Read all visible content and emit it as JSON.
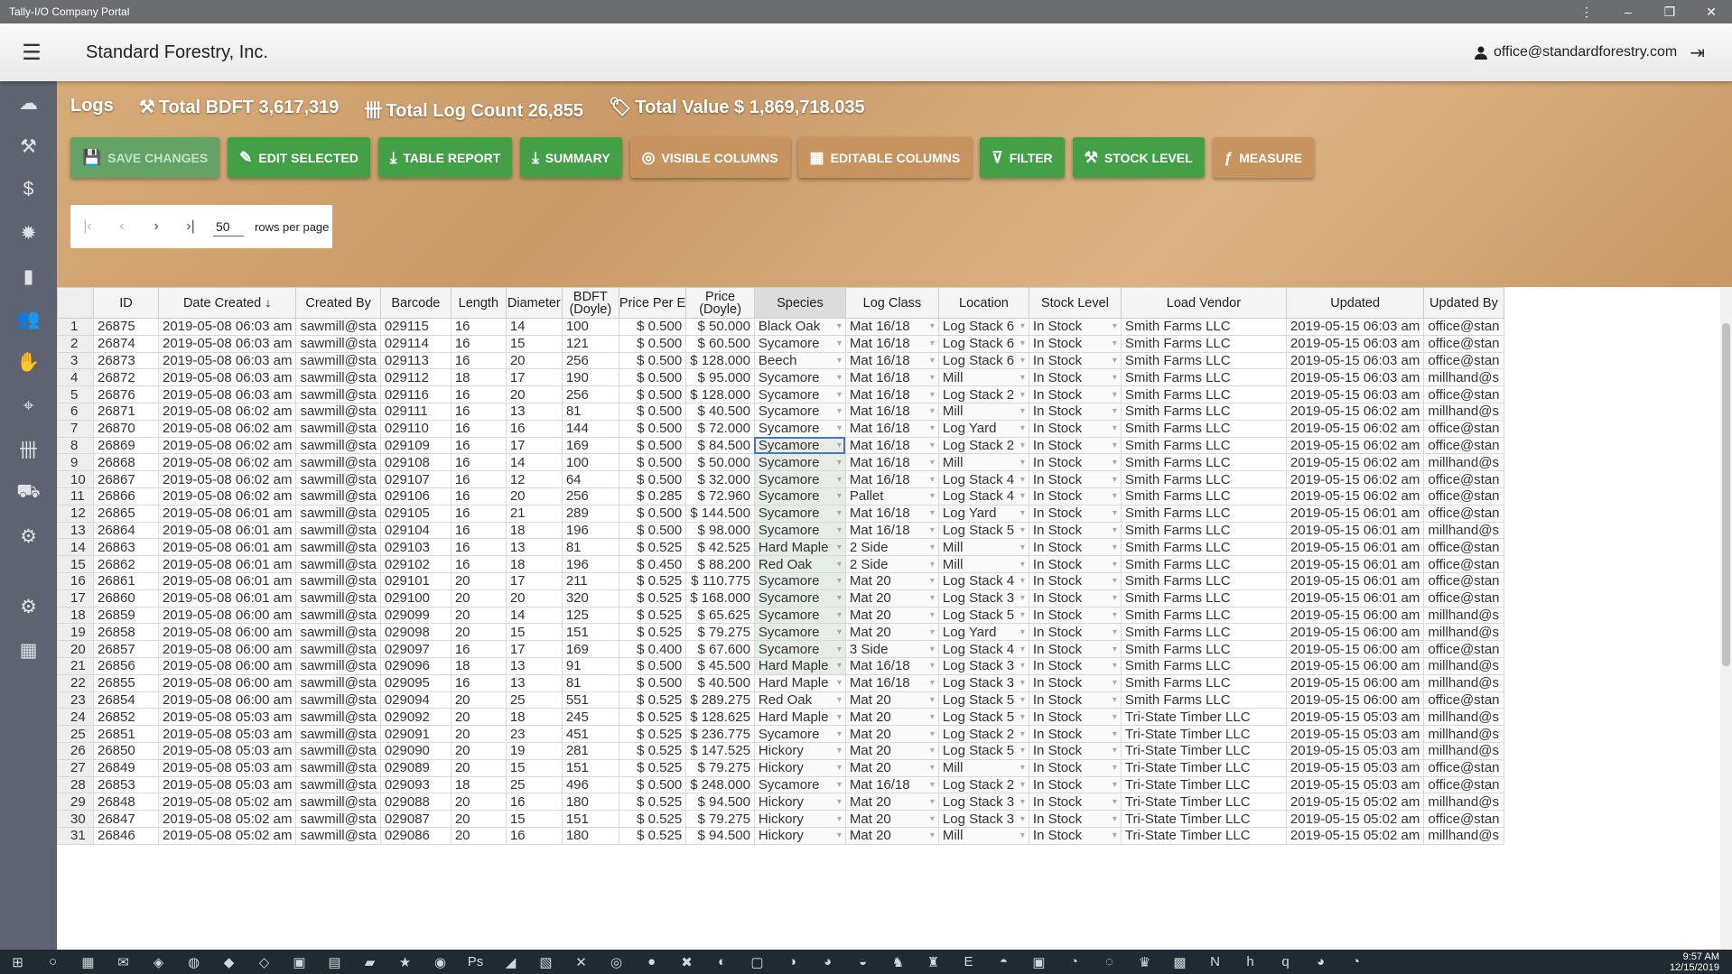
{
  "window": {
    "title": "Tally-I/O Company Portal",
    "controls": [
      "⋮",
      "–",
      "❐",
      "✕"
    ]
  },
  "appbar": {
    "company": "Standard Forestry, Inc.",
    "user_email": "office@standardforestry.com"
  },
  "sidebar_icons": [
    "cloud-icon",
    "hammer-icon",
    "dollar-icon",
    "gear-icon",
    "document-icon",
    "users-icon",
    "handshake-icon",
    "map-pin-icon",
    "tally-icon",
    "truck-icon",
    "forklift-icon",
    "settings-icon",
    "dashboard-icon"
  ],
  "stats": {
    "logs": "Logs",
    "bdft": "Total BDFT 3,617,319",
    "count": "Total Log Count 26,855",
    "value": "Total Value $ 1,869,718.035"
  },
  "toolbar": [
    {
      "name": "save-changes-button",
      "label": "SAVE CHANGES",
      "icon": "💾",
      "style": "disabled"
    },
    {
      "name": "edit-selected-button",
      "label": "EDIT SELECTED",
      "icon": "✎",
      "style": "green"
    },
    {
      "name": "table-report-button",
      "label": "TABLE REPORT",
      "icon": "⤓",
      "style": "green"
    },
    {
      "name": "summary-button",
      "label": "SUMMARY",
      "icon": "⤓",
      "style": "green"
    },
    {
      "name": "visible-columns-button",
      "label": "VISIBLE COLUMNS",
      "icon": "◎",
      "style": "tan"
    },
    {
      "name": "editable-columns-button",
      "label": "EDITABLE COLUMNS",
      "icon": "▦",
      "style": "tan"
    },
    {
      "name": "filter-button",
      "label": "FILTER",
      "icon": "⊽",
      "style": "green"
    },
    {
      "name": "stock-level-button",
      "label": "STOCK LEVEL",
      "icon": "⚒",
      "style": "green"
    },
    {
      "name": "measure-button",
      "label": "MEASURE",
      "icon": "ƒ",
      "style": "tan"
    }
  ],
  "pager": {
    "rows": "50",
    "label": "rows per page"
  },
  "columns": [
    "",
    "ID",
    "Date Created ↓",
    "Created By",
    "Barcode",
    "Length",
    "Diameter",
    "BDFT (Doyle)",
    "Price Per E",
    "Price (Doyle)",
    "Species",
    "Log Class",
    "Location",
    "Stock Level",
    "Load Vendor",
    "Updated",
    "Updated By"
  ],
  "rows": [
    [
      "1",
      "26875",
      "2019-05-08 06:03 am",
      "sawmill@sta",
      "029115",
      "16",
      "14",
      "100",
      "$ 0.500",
      "$ 50.000",
      "Black Oak",
      "Mat 16/18",
      "Log Stack 6",
      "In Stock",
      "Smith Farms LLC",
      "2019-05-15 06:03 am",
      "office@stan"
    ],
    [
      "2",
      "26874",
      "2019-05-08 06:03 am",
      "sawmill@sta",
      "029114",
      "16",
      "15",
      "121",
      "$ 0.500",
      "$ 60.500",
      "Sycamore",
      "Mat 16/18",
      "Log Stack 6",
      "In Stock",
      "Smith Farms LLC",
      "2019-05-15 06:03 am",
      "office@stan"
    ],
    [
      "3",
      "26873",
      "2019-05-08 06:03 am",
      "sawmill@sta",
      "029113",
      "16",
      "20",
      "256",
      "$ 0.500",
      "$ 128.000",
      "Beech",
      "Mat 16/18",
      "Log Stack 6",
      "In Stock",
      "Smith Farms LLC",
      "2019-05-15 06:03 am",
      "office@stan"
    ],
    [
      "4",
      "26872",
      "2019-05-08 06:03 am",
      "sawmill@sta",
      "029112",
      "18",
      "17",
      "190",
      "$ 0.500",
      "$ 95.000",
      "Sycamore",
      "Mat 16/18",
      "Mill",
      "In Stock",
      "Smith Farms LLC",
      "2019-05-15 06:03 am",
      "millhand@s"
    ],
    [
      "5",
      "26876",
      "2019-05-08 06:03 am",
      "sawmill@sta",
      "029116",
      "16",
      "20",
      "256",
      "$ 0.500",
      "$ 128.000",
      "Sycamore",
      "Mat 16/18",
      "Log Stack 2",
      "In Stock",
      "Smith Farms LLC",
      "2019-05-15 06:03 am",
      "office@stan"
    ],
    [
      "6",
      "26871",
      "2019-05-08 06:02 am",
      "sawmill@sta",
      "029111",
      "16",
      "13",
      "81",
      "$ 0.500",
      "$ 40.500",
      "Sycamore",
      "Mat 16/18",
      "Mill",
      "In Stock",
      "Smith Farms LLC",
      "2019-05-15 06:02 am",
      "millhand@s"
    ],
    [
      "7",
      "26870",
      "2019-05-08 06:02 am",
      "sawmill@sta",
      "029110",
      "16",
      "16",
      "144",
      "$ 0.500",
      "$ 72.000",
      "Sycamore",
      "Mat 16/18",
      "Log Yard",
      "In Stock",
      "Smith Farms LLC",
      "2019-05-15 06:02 am",
      "office@stan"
    ],
    [
      "8",
      "26869",
      "2019-05-08 06:02 am",
      "sawmill@sta",
      "029109",
      "16",
      "17",
      "169",
      "$ 0.500",
      "$ 84.500",
      "Sycamore",
      "Mat 16/18",
      "Log Stack 2",
      "In Stock",
      "Smith Farms LLC",
      "2019-05-15 06:02 am",
      "office@stan"
    ],
    [
      "9",
      "26868",
      "2019-05-08 06:02 am",
      "sawmill@sta",
      "029108",
      "16",
      "14",
      "100",
      "$ 0.500",
      "$ 50.000",
      "Sycamore",
      "Mat 16/18",
      "Mill",
      "In Stock",
      "Smith Farms LLC",
      "2019-05-15 06:02 am",
      "millhand@s"
    ],
    [
      "10",
      "26867",
      "2019-05-08 06:02 am",
      "sawmill@sta",
      "029107",
      "16",
      "12",
      "64",
      "$ 0.500",
      "$ 32.000",
      "Sycamore",
      "Mat 16/18",
      "Log Stack 4",
      "In Stock",
      "Smith Farms LLC",
      "2019-05-15 06:02 am",
      "office@stan"
    ],
    [
      "11",
      "26866",
      "2019-05-08 06:02 am",
      "sawmill@sta",
      "029106",
      "16",
      "20",
      "256",
      "$ 0.285",
      "$ 72.960",
      "Sycamore",
      "Pallet",
      "Log Stack 4",
      "In Stock",
      "Smith Farms LLC",
      "2019-05-15 06:02 am",
      "office@stan"
    ],
    [
      "12",
      "26865",
      "2019-05-08 06:01 am",
      "sawmill@sta",
      "029105",
      "16",
      "21",
      "289",
      "$ 0.500",
      "$ 144.500",
      "Sycamore",
      "Mat 16/18",
      "Log Yard",
      "In Stock",
      "Smith Farms LLC",
      "2019-05-15 06:01 am",
      "office@stan"
    ],
    [
      "13",
      "26864",
      "2019-05-08 06:01 am",
      "sawmill@sta",
      "029104",
      "16",
      "18",
      "196",
      "$ 0.500",
      "$ 98.000",
      "Sycamore",
      "Mat 16/18",
      "Log Stack 5",
      "In Stock",
      "Smith Farms LLC",
      "2019-05-15 06:01 am",
      "millhand@s"
    ],
    [
      "14",
      "26863",
      "2019-05-08 06:01 am",
      "sawmill@sta",
      "029103",
      "16",
      "13",
      "81",
      "$ 0.525",
      "$ 42.525",
      "Hard Maple",
      "2 Side",
      "Mill",
      "In Stock",
      "Smith Farms LLC",
      "2019-05-15 06:01 am",
      "office@stan"
    ],
    [
      "15",
      "26862",
      "2019-05-08 06:01 am",
      "sawmill@sta",
      "029102",
      "16",
      "18",
      "196",
      "$ 0.450",
      "$ 88.200",
      "Red Oak",
      "2 Side",
      "Mill",
      "In Stock",
      "Smith Farms LLC",
      "2019-05-15 06:01 am",
      "office@stan"
    ],
    [
      "16",
      "26861",
      "2019-05-08 06:01 am",
      "sawmill@sta",
      "029101",
      "20",
      "17",
      "211",
      "$ 0.525",
      "$ 110.775",
      "Sycamore",
      "Mat 20",
      "Log Stack 4",
      "In Stock",
      "Smith Farms LLC",
      "2019-05-15 06:01 am",
      "office@stan"
    ],
    [
      "17",
      "26860",
      "2019-05-08 06:01 am",
      "sawmill@sta",
      "029100",
      "20",
      "20",
      "320",
      "$ 0.525",
      "$ 168.000",
      "Sycamore",
      "Mat 20",
      "Log Stack 3",
      "In Stock",
      "Smith Farms LLC",
      "2019-05-15 06:01 am",
      "office@stan"
    ],
    [
      "18",
      "26859",
      "2019-05-08 06:00 am",
      "sawmill@sta",
      "029099",
      "20",
      "14",
      "125",
      "$ 0.525",
      "$ 65.625",
      "Sycamore",
      "Mat 20",
      "Log Stack 5",
      "In Stock",
      "Smith Farms LLC",
      "2019-05-15 06:00 am",
      "millhand@s"
    ],
    [
      "19",
      "26858",
      "2019-05-08 06:00 am",
      "sawmill@sta",
      "029098",
      "20",
      "15",
      "151",
      "$ 0.525",
      "$ 79.275",
      "Sycamore",
      "Mat 20",
      "Log Yard",
      "In Stock",
      "Smith Farms LLC",
      "2019-05-15 06:00 am",
      "millhand@s"
    ],
    [
      "20",
      "26857",
      "2019-05-08 06:00 am",
      "sawmill@sta",
      "029097",
      "16",
      "17",
      "169",
      "$ 0.400",
      "$ 67.600",
      "Sycamore",
      "3 Side",
      "Log Stack 4",
      "In Stock",
      "Smith Farms LLC",
      "2019-05-15 06:00 am",
      "office@stan"
    ],
    [
      "21",
      "26856",
      "2019-05-08 06:00 am",
      "sawmill@sta",
      "029096",
      "18",
      "13",
      "91",
      "$ 0.500",
      "$ 45.500",
      "Hard Maple",
      "Mat 16/18",
      "Log Stack 3",
      "In Stock",
      "Smith Farms LLC",
      "2019-05-15 06:00 am",
      "millhand@s"
    ],
    [
      "22",
      "26855",
      "2019-05-08 06:00 am",
      "sawmill@sta",
      "029095",
      "16",
      "13",
      "81",
      "$ 0.500",
      "$ 40.500",
      "Hard Maple",
      "Mat 16/18",
      "Log Stack 3",
      "In Stock",
      "Smith Farms LLC",
      "2019-05-15 06:00 am",
      "millhand@s"
    ],
    [
      "23",
      "26854",
      "2019-05-08 06:00 am",
      "sawmill@sta",
      "029094",
      "20",
      "25",
      "551",
      "$ 0.525",
      "$ 289.275",
      "Red Oak",
      "Mat 20",
      "Log Stack 5",
      "In Stock",
      "Smith Farms LLC",
      "2019-05-15 06:00 am",
      "office@stan"
    ],
    [
      "24",
      "26852",
      "2019-05-08 05:03 am",
      "sawmill@sta",
      "029092",
      "20",
      "18",
      "245",
      "$ 0.525",
      "$ 128.625",
      "Hard Maple",
      "Mat 20",
      "Log Stack 5",
      "In Stock",
      "Tri-State Timber LLC",
      "2019-05-15 05:03 am",
      "millhand@s"
    ],
    [
      "25",
      "26851",
      "2019-05-08 05:03 am",
      "sawmill@sta",
      "029091",
      "20",
      "23",
      "451",
      "$ 0.525",
      "$ 236.775",
      "Sycamore",
      "Mat 20",
      "Log Stack 2",
      "In Stock",
      "Tri-State Timber LLC",
      "2019-05-15 05:03 am",
      "millhand@s"
    ],
    [
      "26",
      "26850",
      "2019-05-08 05:03 am",
      "sawmill@sta",
      "029090",
      "20",
      "19",
      "281",
      "$ 0.525",
      "$ 147.525",
      "Hickory",
      "Mat 20",
      "Log Stack 5",
      "In Stock",
      "Tri-State Timber LLC",
      "2019-05-15 05:03 am",
      "millhand@s"
    ],
    [
      "27",
      "26849",
      "2019-05-08 05:03 am",
      "sawmill@sta",
      "029089",
      "20",
      "15",
      "151",
      "$ 0.525",
      "$ 79.275",
      "Hickory",
      "Mat 20",
      "Mill",
      "In Stock",
      "Tri-State Timber LLC",
      "2019-05-15 05:03 am",
      "office@stan"
    ],
    [
      "28",
      "26853",
      "2019-05-08 05:03 am",
      "sawmill@sta",
      "029093",
      "18",
      "25",
      "496",
      "$ 0.500",
      "$ 248.000",
      "Sycamore",
      "Mat 16/18",
      "Log Stack 2",
      "In Stock",
      "Tri-State Timber LLC",
      "2019-05-15 05:03 am",
      "office@stan"
    ],
    [
      "29",
      "26848",
      "2019-05-08 05:02 am",
      "sawmill@sta",
      "029088",
      "20",
      "16",
      "180",
      "$ 0.525",
      "$ 94.500",
      "Hickory",
      "Mat 20",
      "Log Stack 3",
      "In Stock",
      "Tri-State Timber LLC",
      "2019-05-15 05:02 am",
      "millhand@s"
    ],
    [
      "30",
      "26847",
      "2019-05-08 05:02 am",
      "sawmill@sta",
      "029087",
      "20",
      "15",
      "151",
      "$ 0.525",
      "$ 79.275",
      "Hickory",
      "Mat 20",
      "Log Stack 3",
      "In Stock",
      "Tri-State Timber LLC",
      "2019-05-15 05:02 am",
      "office@stan"
    ],
    [
      "31",
      "26846",
      "2019-05-08 05:02 am",
      "sawmill@sta",
      "029086",
      "20",
      "16",
      "180",
      "$ 0.525",
      "$ 94.500",
      "Hickory",
      "Mat 20",
      "Mill",
      "In Stock",
      "Tri-State Timber LLC",
      "2019-05-15 05:02 am",
      "millhand@s"
    ]
  ],
  "selection": {
    "species_selected_rows": [
      "8",
      "9",
      "10",
      "11",
      "12",
      "13",
      "14",
      "15",
      "16",
      "17",
      "18",
      "19",
      "20",
      "21"
    ],
    "active_row": "8"
  },
  "taskbar": {
    "time": "9:57 AM",
    "date": "12/15/2019"
  }
}
